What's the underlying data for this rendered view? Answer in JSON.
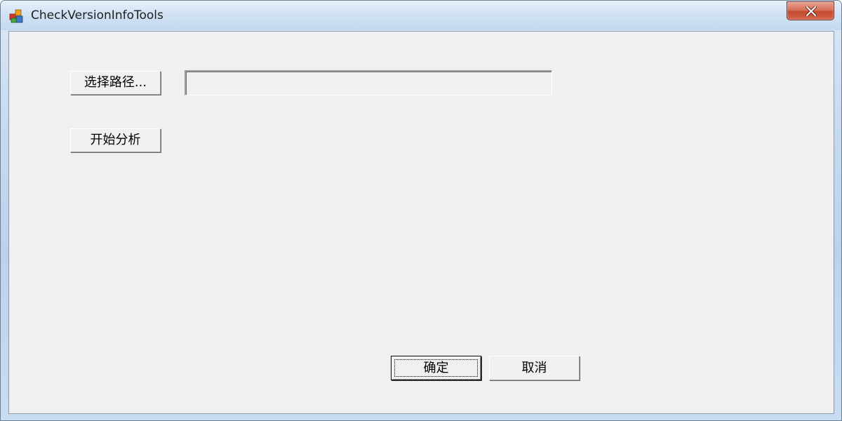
{
  "window": {
    "title": "CheckVersionInfoTools",
    "app_icon": "app-cubes-icon",
    "close_icon": "close-icon"
  },
  "controls": {
    "select_path_label": "选择路径...",
    "path_value": "",
    "path_placeholder": "",
    "start_analysis_label": "开始分析",
    "ok_label": "确定",
    "cancel_label": "取消"
  },
  "colors": {
    "client_background": "#f0f0f0",
    "titlebar": "#c4d9f0",
    "close_button": "#c24a30"
  }
}
